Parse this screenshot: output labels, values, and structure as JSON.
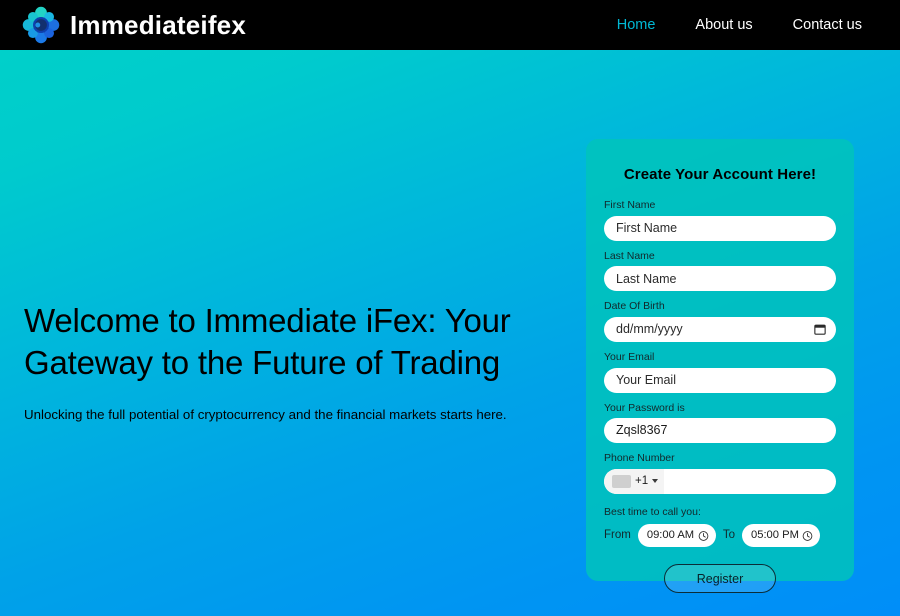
{
  "header": {
    "brand_name": "Immediateifex",
    "logo_icon": "petal-cluster-logo-icon",
    "nav": [
      {
        "label": "Home",
        "active": true
      },
      {
        "label": "About us",
        "active": false
      },
      {
        "label": "Contact us",
        "active": false
      }
    ]
  },
  "hero": {
    "title": "Welcome to Immediate iFex: Your Gateway to the Future of Trading",
    "subtitle": "Unlocking the full potential of cryptocurrency and the financial markets starts here."
  },
  "form": {
    "title": "Create Your Account Here!",
    "fields": [
      {
        "label": "First Name",
        "value": "",
        "placeholder": "First Name"
      },
      {
        "label": "Last Name",
        "value": "",
        "placeholder": "Last Name"
      },
      {
        "label": "Date Of Birth",
        "value": "",
        "placeholder": "dd/mm/yyyy",
        "icon": "calendar-icon"
      },
      {
        "label": "Your Email",
        "value": "",
        "placeholder": "Your Email"
      },
      {
        "label": "Your Password is",
        "value": "Zqsl8367",
        "placeholder": ""
      }
    ],
    "phone": {
      "label": "Phone Number",
      "country_code": "+1",
      "flag_icon": "country-flag-icon",
      "caret_icon": "chevron-down-icon",
      "value": "",
      "placeholder": ""
    },
    "call_time": {
      "label": "Best time to call you:",
      "from_word": "From",
      "from_value": "09:00 AM",
      "to_word": "To",
      "to_value": "05:00 PM",
      "clock_icon": "clock-icon"
    },
    "submit_label": "Register"
  },
  "colors": {
    "header_bg": "#000000",
    "nav_active": "#00b8d4",
    "gradient_start": "#00d2c8",
    "gradient_end": "#008ef8",
    "card_bg": "#00c4ba",
    "input_bg": "#ffffff",
    "text_dark": "#000000"
  }
}
